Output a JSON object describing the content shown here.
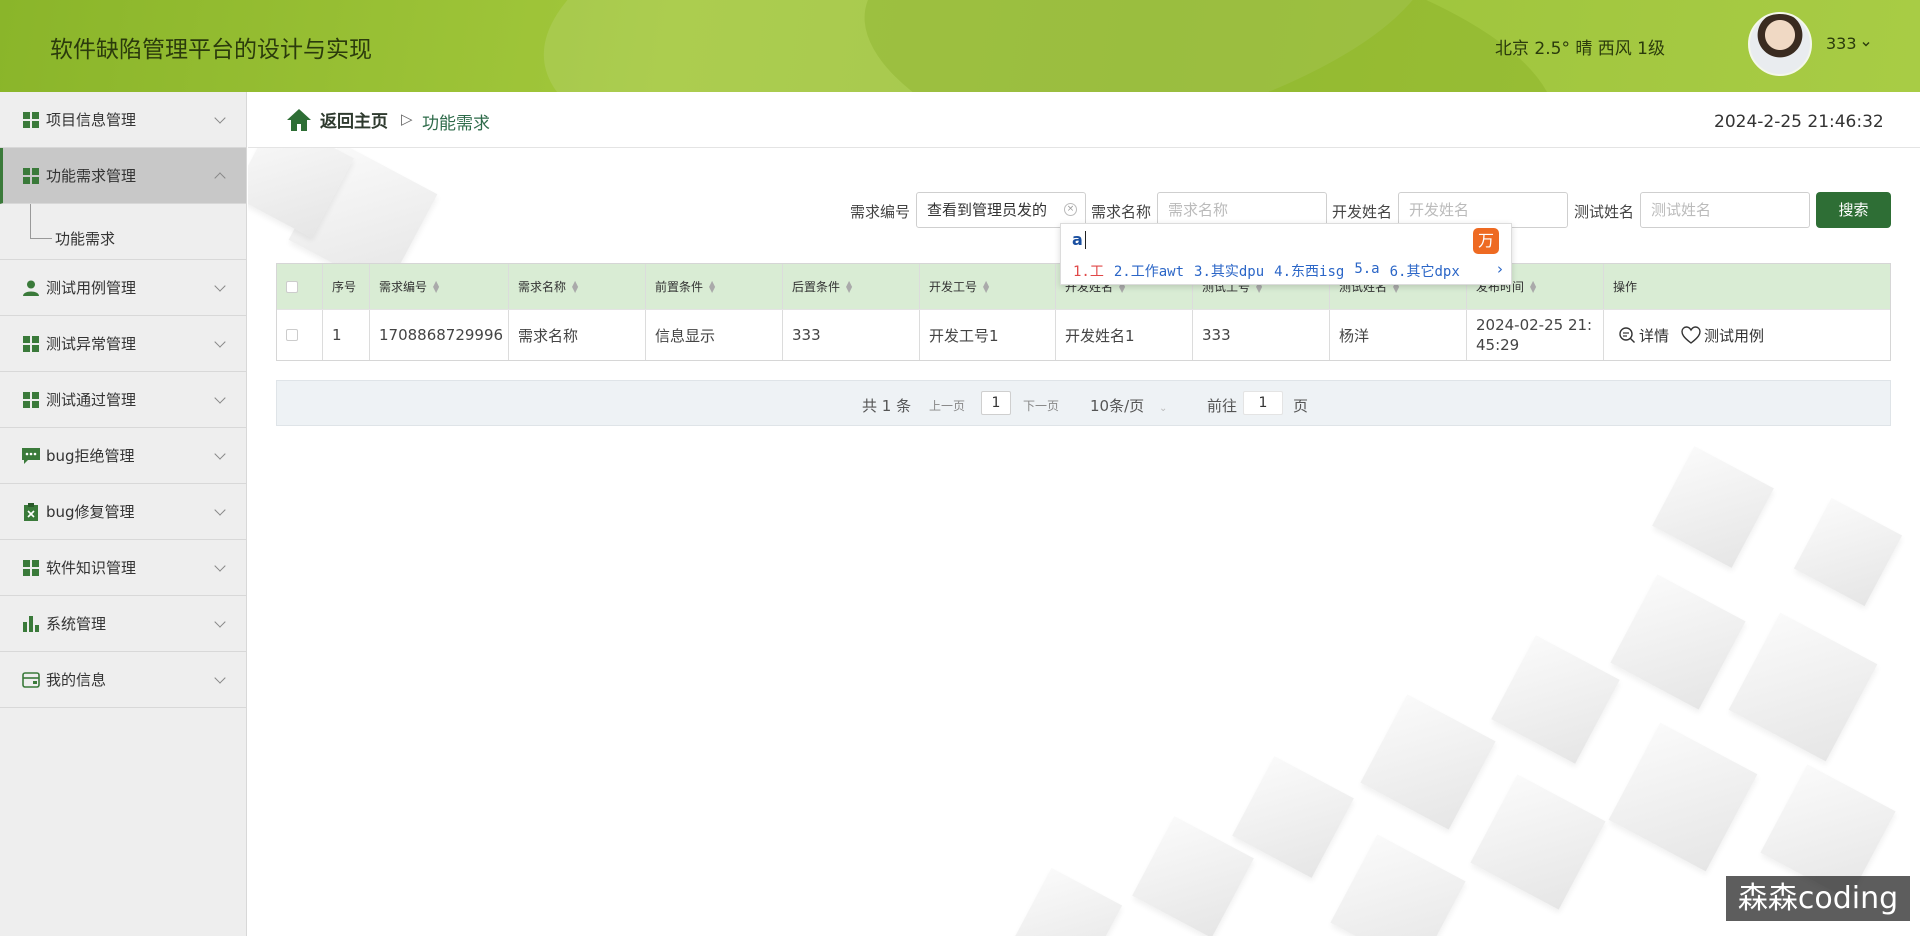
{
  "header": {
    "title": "软件缺陷管理平台的设计与实现",
    "weather": "北京 2.5° 晴 西风 1级",
    "username": "333"
  },
  "sidebar": {
    "items": [
      {
        "label": "项目信息管理",
        "icon": "grid-icon"
      },
      {
        "label": "功能需求管理",
        "icon": "grid-icon",
        "active": true
      },
      {
        "label": "测试用例管理",
        "icon": "user-icon"
      },
      {
        "label": "测试异常管理",
        "icon": "grid-icon"
      },
      {
        "label": "测试通过管理",
        "icon": "grid-icon"
      },
      {
        "label": "bug拒绝管理",
        "icon": "chat-icon"
      },
      {
        "label": "bug修复管理",
        "icon": "clipboard-icon"
      },
      {
        "label": "软件知识管理",
        "icon": "grid-icon"
      },
      {
        "label": "系统管理",
        "icon": "bar-chart-icon"
      },
      {
        "label": "我的信息",
        "icon": "card-icon"
      }
    ],
    "submenu_label": "功能需求"
  },
  "breadcrumb": {
    "home": "返回主页",
    "separator": "▷",
    "current": "功能需求"
  },
  "datetime": "2024-2-25 21:46:32",
  "search": {
    "fields": [
      {
        "label": "需求编号",
        "value": "查看到管理员发的",
        "placeholder": ""
      },
      {
        "label": "需求名称",
        "value": "",
        "placeholder": "需求名称"
      },
      {
        "label": "开发姓名",
        "value": "",
        "placeholder": "开发姓名"
      },
      {
        "label": "测试姓名",
        "value": "",
        "placeholder": "测试姓名"
      }
    ],
    "button": "搜索"
  },
  "ime": {
    "typed": "a",
    "candidates": [
      "1.工",
      "2.工作awt",
      "3.其实dpu",
      "4.东西isg",
      "5.a",
      "6.其它dpx"
    ],
    "next": "›"
  },
  "table": {
    "columns": [
      "序号",
      "需求编号",
      "需求名称",
      "前置条件",
      "后置条件",
      "开发工号",
      "开发姓名",
      "测试工号",
      "测试姓名",
      "发布时间",
      "操作"
    ],
    "rows": [
      {
        "index": "1",
        "code": "1708868729996",
        "name": "需求名称",
        "pre": "信息显示",
        "post": "333",
        "dev_id": "开发工号1",
        "dev_name": "开发姓名1",
        "test_id": "333",
        "test_name": "杨洋",
        "time_line1": "2024-02-25 21:",
        "time_line2": "45:29",
        "op_detail": "详情",
        "op_case": "测试用例"
      }
    ]
  },
  "pagination": {
    "total": "共 1 条",
    "prev": "上一页",
    "page": "1",
    "next": "下一页",
    "page_size": "10条/页",
    "goto_label": "前往",
    "goto_value": "1",
    "page_suffix": "页"
  },
  "watermark": "森森coding",
  "colors": {
    "header_green": "#a3c83c",
    "primary_green": "#2e6e35",
    "table_header": "#d9ecd4"
  }
}
